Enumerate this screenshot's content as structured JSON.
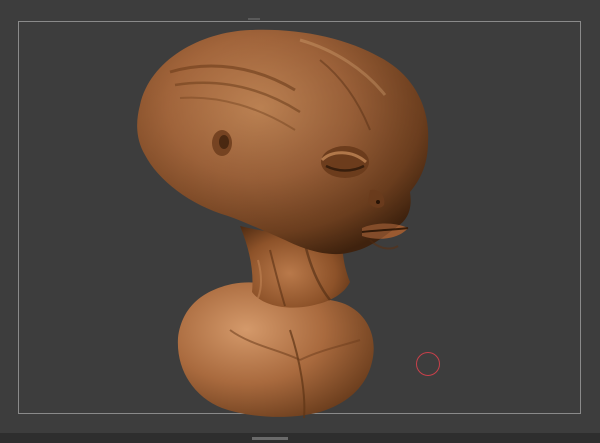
{
  "viewport": {
    "background_color": "#3d3d3d",
    "frame_color": "#8a8a8a"
  },
  "model": {
    "description_icon": "alien-bust-sculpt",
    "material_color": "#a8693f"
  },
  "cursor": {
    "icon": "brush-cursor-ring",
    "color": "#c8404a"
  }
}
